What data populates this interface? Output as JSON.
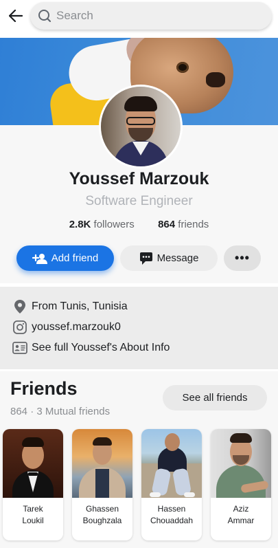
{
  "search": {
    "placeholder": "Search"
  },
  "profile": {
    "name": "Youssef Marzouk",
    "job": "Software Engineer",
    "followers_count": "2.8K",
    "followers_label": "followers",
    "friends_count": "864",
    "friends_label": "friends"
  },
  "actions": {
    "add_friend": "Add friend",
    "message": "Message",
    "more": "•••"
  },
  "about": {
    "location": "From Tunis, Tunisia",
    "instagram": "youssef.marzouk0",
    "about_info": "See full Youssef's About Info"
  },
  "friends": {
    "title": "Friends",
    "subtitle": "864 · 3 Mutual friends",
    "see_all": "See all friends",
    "list": [
      {
        "first": "Tarek",
        "last": "Loukil"
      },
      {
        "first": "Ghassen",
        "last": "Boughzala"
      },
      {
        "first": "Hassen",
        "last": "Chouaddah"
      },
      {
        "first": "Aziz",
        "last": "Ammar"
      }
    ]
  },
  "colors": {
    "accent": "#1b74e4",
    "muted_text": "#b0b3b8"
  },
  "icons": [
    "back-arrow-icon",
    "search-icon",
    "add-person-icon",
    "chat-icon",
    "location-pin-icon",
    "instagram-icon",
    "id-card-icon"
  ]
}
